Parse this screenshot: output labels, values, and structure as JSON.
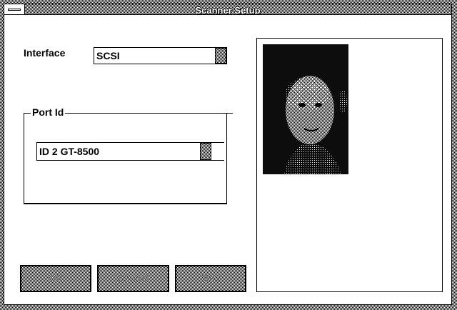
{
  "window": {
    "title": "Scanner Setup"
  },
  "interface": {
    "label": "Interface",
    "value": "SCSI"
  },
  "port": {
    "group_label": "Port Id",
    "value": "ID  2  GT-8500"
  },
  "buttons": {
    "ok": "OK",
    "cancel": "Cancel",
    "test": "Test"
  },
  "icons": {
    "system_menu": "system-menu-icon",
    "dropdown": "dropdown-arrow-icon"
  }
}
